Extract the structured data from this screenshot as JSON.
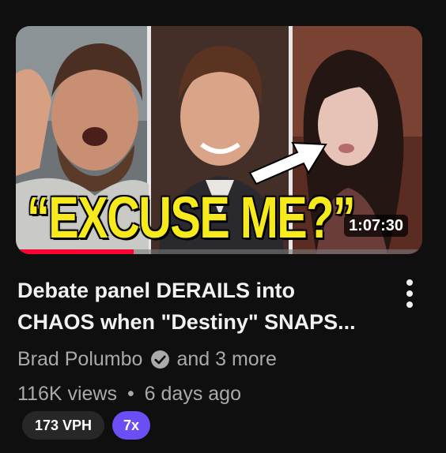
{
  "video": {
    "thumbnail_caption": "“EXCUSE ME?”",
    "duration": "1:07:30",
    "watch_progress_fraction": 0.29,
    "title_line1": "Debate panel DERAILS into",
    "title_line2": "CHAOS when \"Destiny\" SNAPS...",
    "channel": "Brad Polumbo",
    "collaborators": "and 3 more",
    "views": "116K views",
    "separator": "•",
    "age": "6 days ago"
  },
  "badges": {
    "vph": "173 VPH",
    "multiplier": "7x"
  },
  "icons": {
    "verified": "verified-check-icon",
    "more": "more-vertical-icon"
  },
  "colors": {
    "background": "#0f0f0f",
    "progress": "#ff0033",
    "caption_yellow": "#f7ea1c",
    "multiplier_badge": "#6c4ef5"
  }
}
